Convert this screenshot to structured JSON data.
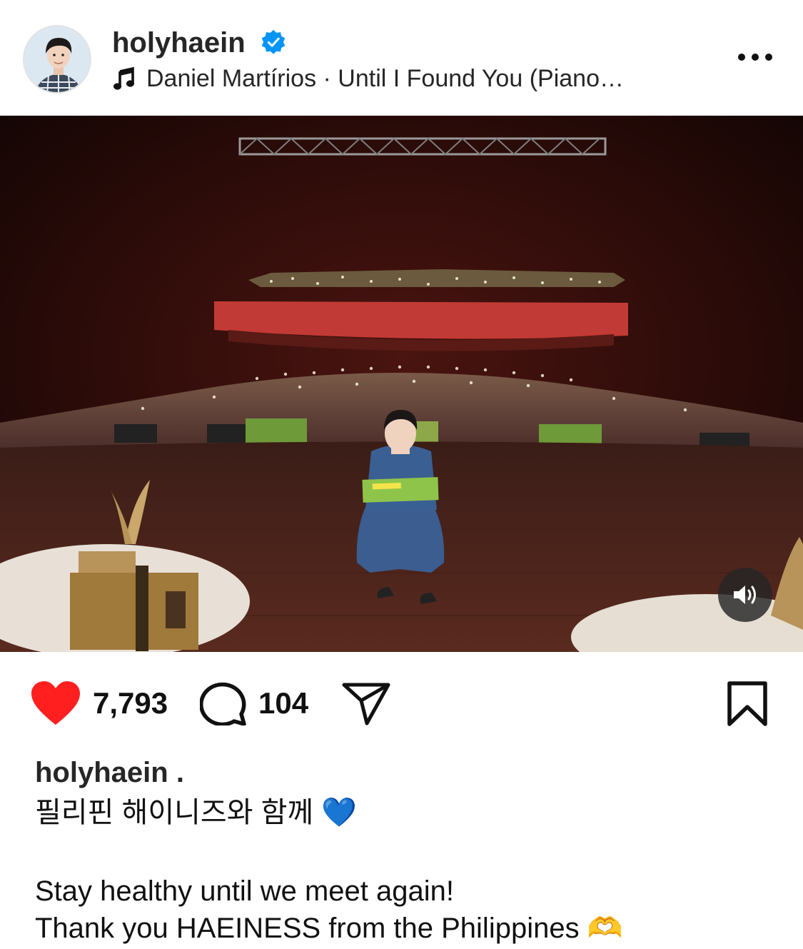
{
  "post": {
    "username": "holyhaein",
    "verified": true,
    "music": {
      "icon": "music-note-icon",
      "text": "Daniel Martírios · Until I Found You (Piano…"
    },
    "more_icon": "more-options-icon"
  },
  "actions": {
    "like": {
      "icon": "heart-filled-icon",
      "count": "7,793",
      "color": "#ff3040"
    },
    "comment": {
      "icon": "comment-icon",
      "count": "104"
    },
    "share": {
      "icon": "send-icon"
    },
    "save": {
      "icon": "bookmark-icon"
    }
  },
  "caption": {
    "username": "holyhaein .",
    "line1": "필리핀 해이니즈와 함께 💙",
    "line2": "Stay healthy until we meet again!",
    "line3": "Thank you HAEINESS from the Philippines 🫶"
  },
  "colors": {
    "verified": "#0095f6",
    "text": "#262626"
  }
}
